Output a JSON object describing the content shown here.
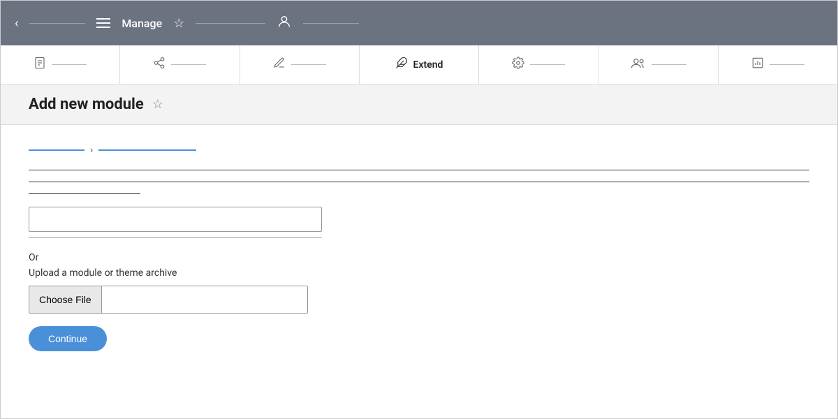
{
  "top_nav": {
    "title": "Manage",
    "back_label": "‹",
    "star_label": "☆"
  },
  "tabs": [
    {
      "id": "page",
      "icon": "📄",
      "label": "",
      "active": false
    },
    {
      "id": "share",
      "icon": "🔗",
      "label": "",
      "active": false
    },
    {
      "id": "edit",
      "icon": "✏️",
      "label": "",
      "active": false
    },
    {
      "id": "extend",
      "icon": "🧩",
      "label": "Extend",
      "active": true
    },
    {
      "id": "settings",
      "icon": "🔧",
      "label": "",
      "active": false
    },
    {
      "id": "users",
      "icon": "👥",
      "label": "",
      "active": false
    },
    {
      "id": "analytics",
      "icon": "📊",
      "label": "",
      "active": false
    }
  ],
  "page_header": {
    "title": "Add new module",
    "star_icon": "☆"
  },
  "form": {
    "or_label": "Or",
    "upload_label": "Upload a module or theme archive",
    "choose_file_label": "Choose File",
    "continue_label": "Continue",
    "file_placeholder": ""
  }
}
